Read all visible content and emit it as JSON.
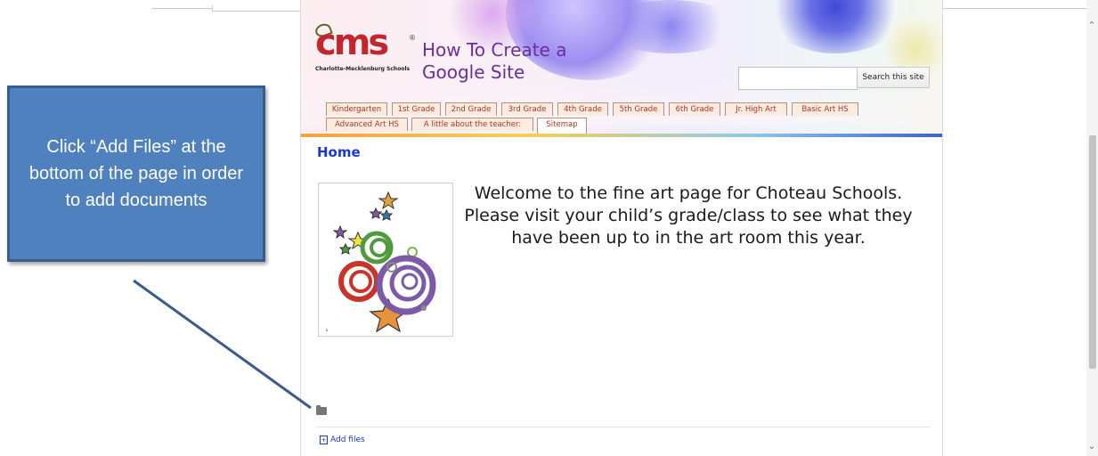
{
  "site": {
    "logo_text": "cms",
    "logo_subtext": "Charlotte-Mecklenburg Schools",
    "logo_reg": "®",
    "title_line1": "How To Create a",
    "title_line2": "Google Site",
    "search_button": "Search this site",
    "search_placeholder": "",
    "tabs": [
      {
        "label": "Kindergarten"
      },
      {
        "label": "1st Grade"
      },
      {
        "label": "2nd Grade"
      },
      {
        "label": "3rd Grade"
      },
      {
        "label": "4th Grade"
      },
      {
        "label": "5th Grade"
      },
      {
        "label": "6th Grade"
      },
      {
        "label": "Jr. High Art"
      },
      {
        "label": "Basic Art HS"
      },
      {
        "label": "Advanced Art HS"
      },
      {
        "label": "A little about the teacher:"
      },
      {
        "label": "Sitemap"
      }
    ],
    "active_tab": "Sitemap",
    "page_title": "Home",
    "welcome_text": "Welcome to the fine art page for Choteau Schools. Please visit your child’s grade/class to see what they have been up to in the art room this year.",
    "add_files_label": "Add files"
  },
  "callout": {
    "text": "Click “Add Files” at the bottom of the page in order to add documents",
    "color": "#4e81bd",
    "border_color": "#385d8a"
  },
  "icons": {
    "folder": "folder-icon",
    "add_file": "add-file-icon",
    "scroll_up": "chevron-up-icon",
    "scroll_down": "chevron-down-icon"
  }
}
